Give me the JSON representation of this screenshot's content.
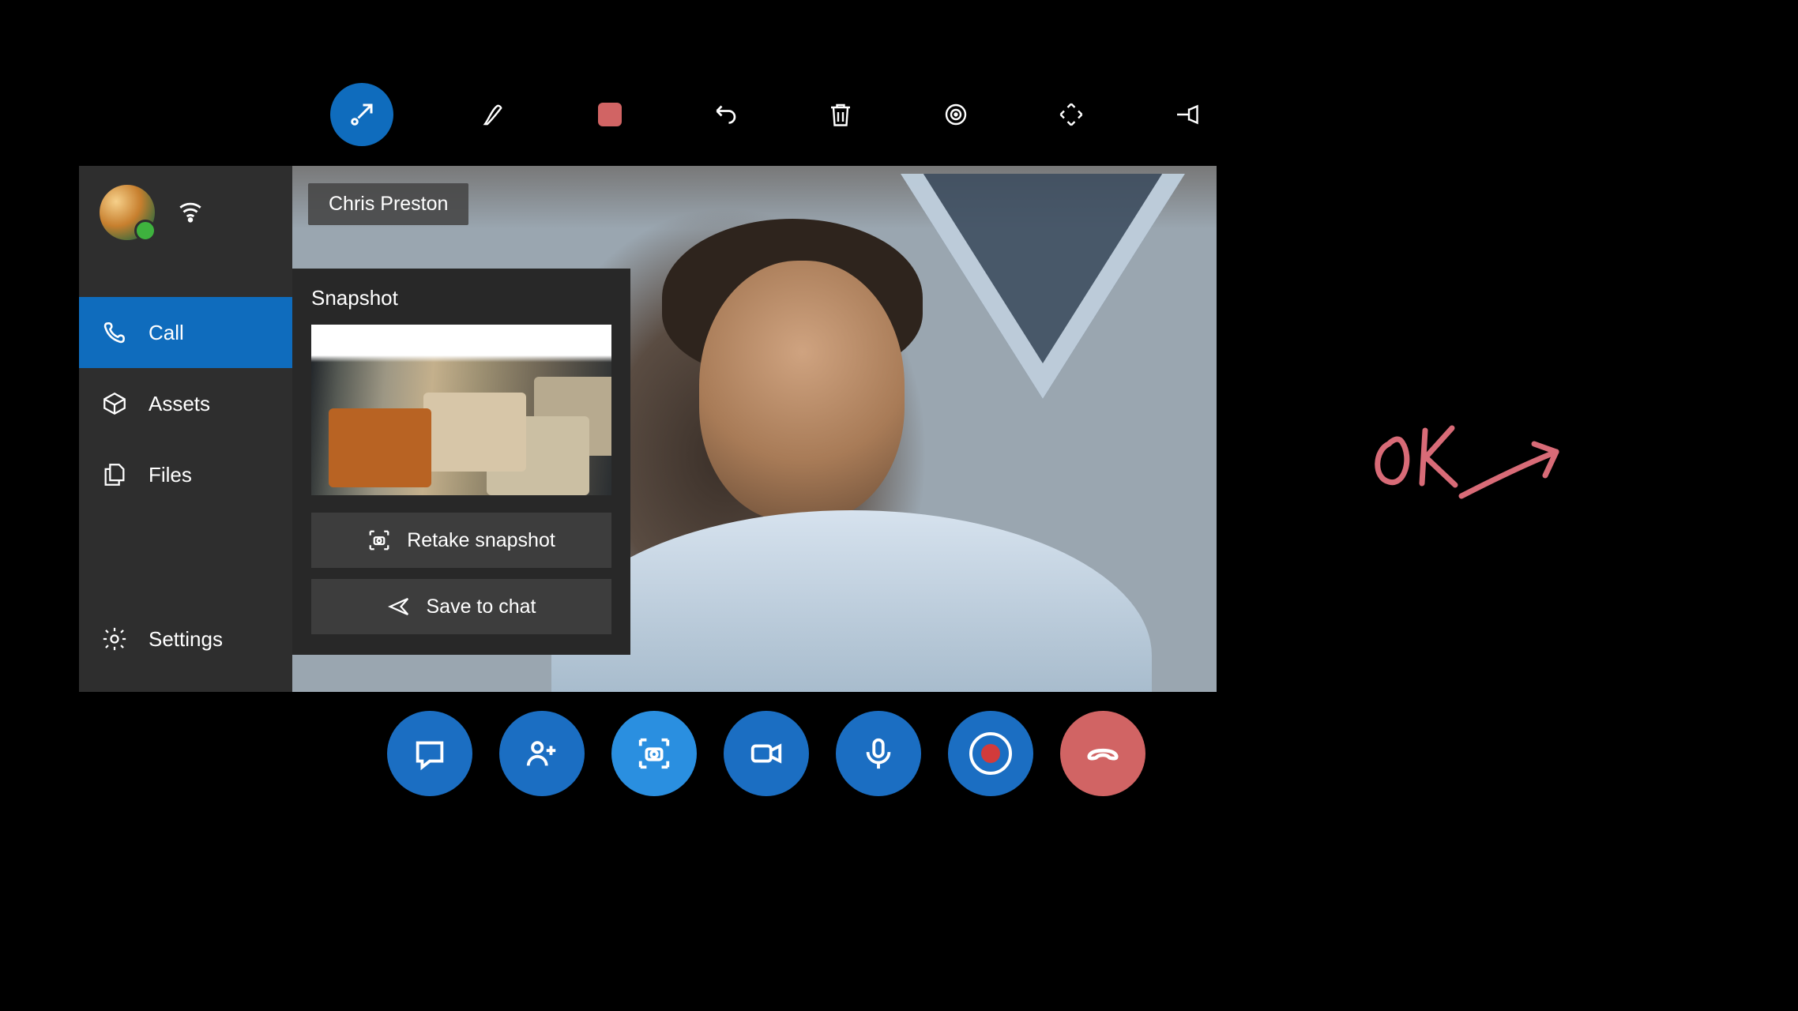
{
  "caller_name": "Chris Preston",
  "sidebar": {
    "items": [
      {
        "label": "Call"
      },
      {
        "label": "Assets"
      },
      {
        "label": "Files"
      }
    ],
    "settings_label": "Settings"
  },
  "snapshot": {
    "title": "Snapshot",
    "retake_label": "Retake snapshot",
    "save_label": "Save to chat"
  },
  "annotation_text": "OK",
  "colors": {
    "accent": "#0f6cbd",
    "danger": "#d16464",
    "annotation": "#d86b77"
  }
}
